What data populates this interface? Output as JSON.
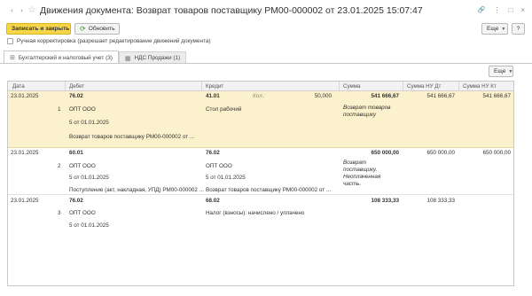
{
  "window": {
    "title": "Движения документа: Возврат товаров поставщику РМ00-000002 от 23.01.2025 15:07:47",
    "back_icon": "‹",
    "forward_icon": "›",
    "star_icon": "☆",
    "link_icon": "🔗",
    "more_icon": "⋮",
    "maximize_icon": "□",
    "close_icon": "×"
  },
  "toolbar": {
    "save_close_label": "Записать и закрыть",
    "refresh_label": "Обновить",
    "refresh_icon": "⟳",
    "more_label": "Еще",
    "help_label": "?"
  },
  "manual_checkbox_label": "Ручная корректировка (разрешает редактирование движений документа)",
  "tabs": [
    {
      "label": "Бухгалтерский и налоговый учет (3)",
      "icon": "⊞"
    },
    {
      "label": "НДС Продажи (1)",
      "icon": "▦"
    }
  ],
  "panel": {
    "more_label": "Еще"
  },
  "columns": {
    "date": "Дата",
    "debit": "Дебет",
    "credit": "Кредит",
    "sum": "Сумма",
    "sum_nu_dt": "Сумма НУ Дт",
    "sum_nu_kt": "Сумма НУ Кт"
  },
  "rows": [
    {
      "date": "23.01.2025",
      "num": "1",
      "debit_account": "76.02",
      "debit_sub1": "ОПТ ООО",
      "debit_sub2": "5 от 01.01.2025",
      "debit_sub3": "Возврат товаров поставщику РМ00-000002 от ...",
      "credit_account": "41.01",
      "qty_label": "Кол.:",
      "qty": "50,000",
      "credit_sub1": "Стол рабочий",
      "sum": "541 666,67",
      "sum_note": "Возврат товаров поставщику",
      "sum_nu_dt": "541 666,67",
      "sum_nu_kt": "541 666,67"
    },
    {
      "date": "23.01.2025",
      "num": "2",
      "debit_account": "60.01",
      "debit_sub1": "ОПТ ООО",
      "debit_sub2": "5 от 01.01.2025",
      "debit_sub3": "Поступление (акт, накладная, УПД) РМ00-000002 ...",
      "credit_account": "76.02",
      "credit_sub1": "ОПТ ООО",
      "credit_sub2": "5 от 01.01.2025",
      "credit_sub3": "Возврат товаров поставщику РМ00-000002 от ...",
      "sum": "650 000,00",
      "sum_note": "Возврат поставщику. Неоплаченная часть.",
      "sum_nu_dt": "650 000,00",
      "sum_nu_kt": "650 000,00"
    },
    {
      "date": "23.01.2025",
      "num": "3",
      "debit_account": "76.02",
      "debit_sub1": "ОПТ ООО",
      "debit_sub2": "5 от 01.01.2025",
      "credit_account": "68.02",
      "credit_sub1": "Налог (взносы): начислено / уплачено",
      "sum": "108 333,33",
      "sum_nu_dt": "108 333,33"
    }
  ],
  "colors": {
    "primary_button": "#f6d648",
    "selected_row": "#fbf1cc",
    "refresh_icon": "#4a9c3a"
  }
}
